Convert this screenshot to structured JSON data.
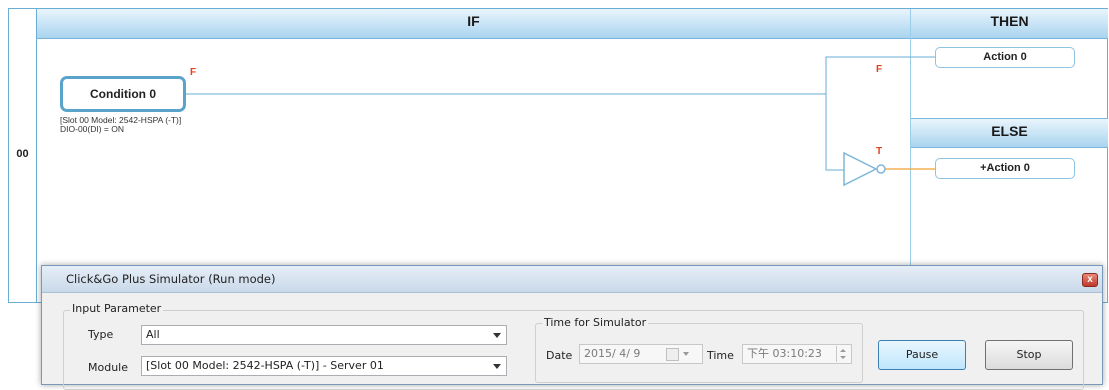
{
  "rule": {
    "row_number": "00",
    "if_label": "IF",
    "then_label": "THEN",
    "else_label": "ELSE",
    "condition": {
      "label": "Condition 0",
      "flag": "F",
      "detail_line1": "[Slot 00 Model: 2542-HSPA (-T)]",
      "detail_line2": "DIO-00(DI) = ON"
    },
    "then_flag": "F",
    "else_flag": "T",
    "then_action": "Action 0",
    "else_action": "+Action 0",
    "colors": {
      "line_blue": "#6aaed6",
      "line_orange": "#f0a030",
      "flag_red": "#e0421c"
    }
  },
  "dialog": {
    "title": "Click&Go Plus Simulator (Run mode)",
    "input_group_label": "Input Parameter",
    "type_label": "Type",
    "type_value": "All",
    "module_label": "Module",
    "module_value": "[Slot 00 Model: 2542-HSPA (-T)] - Server 01",
    "time_group_label": "Time for Simulator",
    "date_label": "Date",
    "date_value": "2015/ 4/ 9",
    "time_label": "Time",
    "time_value": "下午 03:10:23",
    "pause_label": "Pause",
    "stop_label": "Stop",
    "close_glyph": "x"
  }
}
